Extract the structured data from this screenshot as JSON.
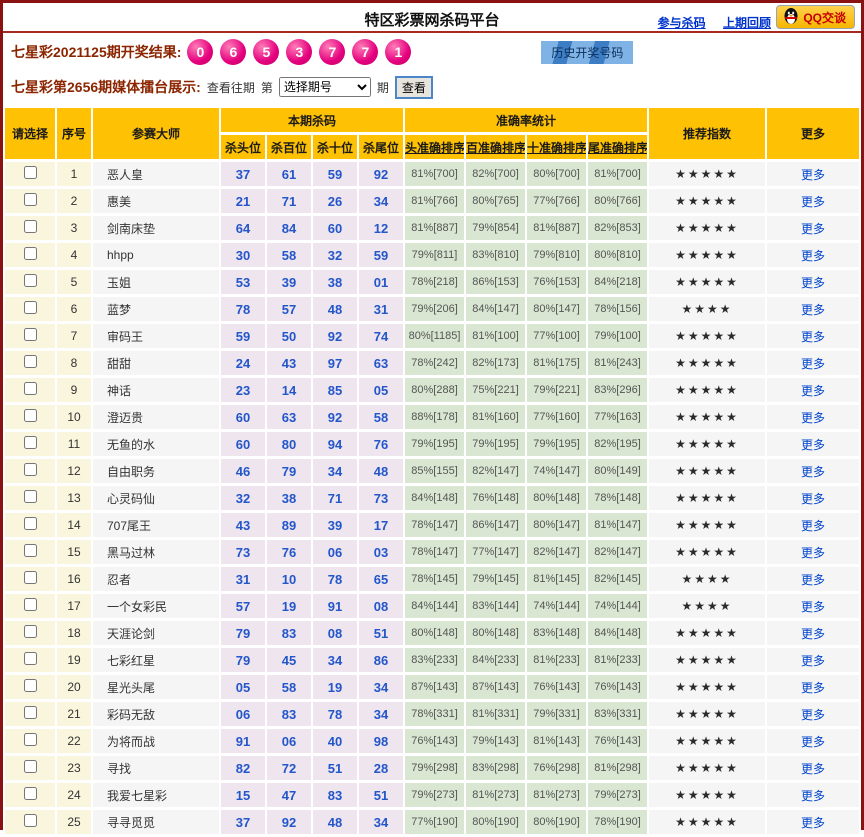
{
  "header": {
    "title": "特区彩票网杀码平台",
    "link_join": "参与杀码",
    "link_last": "上期回顾",
    "qq_button": "QQ交谈"
  },
  "result_bar": {
    "label": "七星彩2021125期开奖结果:",
    "balls": [
      "0",
      "6",
      "5",
      "3",
      "7",
      "7",
      "1"
    ],
    "history_link": "历史开奖号码"
  },
  "control_bar": {
    "label": "七星彩第2656期媒体擂台展示:",
    "view_past": "查看往期",
    "di": "第",
    "select_value": "选择期号",
    "qi": "期",
    "view_button": "查看"
  },
  "colors": {
    "header_gold": "#FFC103",
    "frame_maroon": "#8B1212",
    "ball_pink": "#E4007E",
    "kill_blue": "#2256C9",
    "acc_green_bg": "#D9E7D2",
    "link_blue": "#0033CC"
  },
  "table": {
    "headers": {
      "select": "请选择",
      "index": "序号",
      "master": "参赛大师",
      "kill_group": "本期杀码",
      "kill_cols": [
        "杀头位",
        "杀百位",
        "杀十位",
        "杀尾位"
      ],
      "acc_group": "准确率统计",
      "acc_cols": [
        "头准确排序",
        "百准确排序",
        "十准确排序",
        "尾准确排序"
      ],
      "rating": "推荐指数",
      "more": "更多"
    },
    "more_label": "更多",
    "rows": [
      {
        "index": "1",
        "master": "恶人皇",
        "kills": [
          "37",
          "61",
          "59",
          "92"
        ],
        "acc": [
          "81%[700]",
          "82%[700]",
          "80%[700]",
          "81%[700]"
        ],
        "stars": 5
      },
      {
        "index": "2",
        "master": "惠美",
        "kills": [
          "21",
          "71",
          "26",
          "34"
        ],
        "acc": [
          "81%[766]",
          "80%[765]",
          "77%[766]",
          "80%[766]"
        ],
        "stars": 5
      },
      {
        "index": "3",
        "master": "剑南床垫",
        "kills": [
          "64",
          "84",
          "60",
          "12"
        ],
        "acc": [
          "81%[887]",
          "79%[854]",
          "81%[887]",
          "82%[853]"
        ],
        "stars": 5
      },
      {
        "index": "4",
        "master": "hhpp",
        "kills": [
          "30",
          "58",
          "32",
          "59"
        ],
        "acc": [
          "79%[811]",
          "83%[810]",
          "79%[810]",
          "80%[810]"
        ],
        "stars": 5
      },
      {
        "index": "5",
        "master": "玉姐",
        "kills": [
          "53",
          "39",
          "38",
          "01"
        ],
        "acc": [
          "78%[218]",
          "86%[153]",
          "76%[153]",
          "84%[218]"
        ],
        "stars": 5
      },
      {
        "index": "6",
        "master": "蓝梦",
        "kills": [
          "78",
          "57",
          "48",
          "31"
        ],
        "acc": [
          "79%[206]",
          "84%[147]",
          "80%[147]",
          "78%[156]"
        ],
        "stars": 4
      },
      {
        "index": "7",
        "master": "审码王",
        "kills": [
          "59",
          "50",
          "92",
          "74"
        ],
        "acc": [
          "80%[1185]",
          "81%[100]",
          "77%[100]",
          "79%[100]"
        ],
        "stars": 5
      },
      {
        "index": "8",
        "master": "甜甜",
        "kills": [
          "24",
          "43",
          "97",
          "63"
        ],
        "acc": [
          "78%[242]",
          "82%[173]",
          "81%[175]",
          "81%[243]"
        ],
        "stars": 5
      },
      {
        "index": "9",
        "master": "神话",
        "kills": [
          "23",
          "14",
          "85",
          "05"
        ],
        "acc": [
          "80%[288]",
          "75%[221]",
          "79%[221]",
          "83%[296]"
        ],
        "stars": 5
      },
      {
        "index": "10",
        "master": "澄迈贵",
        "kills": [
          "60",
          "63",
          "92",
          "58"
        ],
        "acc": [
          "88%[178]",
          "81%[160]",
          "77%[160]",
          "77%[163]"
        ],
        "stars": 5
      },
      {
        "index": "11",
        "master": "无鱼的水",
        "kills": [
          "60",
          "80",
          "94",
          "76"
        ],
        "acc": [
          "79%[195]",
          "79%[195]",
          "79%[195]",
          "82%[195]"
        ],
        "stars": 5
      },
      {
        "index": "12",
        "master": "自由职务",
        "kills": [
          "46",
          "79",
          "34",
          "48"
        ],
        "acc": [
          "85%[155]",
          "82%[147]",
          "74%[147]",
          "80%[149]"
        ],
        "stars": 5
      },
      {
        "index": "13",
        "master": "心灵码仙",
        "kills": [
          "32",
          "38",
          "71",
          "73"
        ],
        "acc": [
          "84%[148]",
          "76%[148]",
          "80%[148]",
          "78%[148]"
        ],
        "stars": 5
      },
      {
        "index": "14",
        "master": "707尾王",
        "kills": [
          "43",
          "89",
          "39",
          "17"
        ],
        "acc": [
          "78%[147]",
          "86%[147]",
          "80%[147]",
          "81%[147]"
        ],
        "stars": 5
      },
      {
        "index": "15",
        "master": "黑马过林",
        "kills": [
          "73",
          "76",
          "06",
          "03"
        ],
        "acc": [
          "78%[147]",
          "77%[147]",
          "82%[147]",
          "82%[147]"
        ],
        "stars": 5
      },
      {
        "index": "16",
        "master": "忍者",
        "kills": [
          "31",
          "10",
          "78",
          "65"
        ],
        "acc": [
          "78%[145]",
          "79%[145]",
          "81%[145]",
          "82%[145]"
        ],
        "stars": 4
      },
      {
        "index": "17",
        "master": "一个女彩民",
        "kills": [
          "57",
          "19",
          "91",
          "08"
        ],
        "acc": [
          "84%[144]",
          "83%[144]",
          "74%[144]",
          "74%[144]"
        ],
        "stars": 4
      },
      {
        "index": "18",
        "master": "天涯论剑",
        "kills": [
          "79",
          "83",
          "08",
          "51"
        ],
        "acc": [
          "80%[148]",
          "80%[148]",
          "83%[148]",
          "84%[148]"
        ],
        "stars": 5
      },
      {
        "index": "19",
        "master": "七彩红星",
        "kills": [
          "79",
          "45",
          "34",
          "86"
        ],
        "acc": [
          "83%[233]",
          "84%[233]",
          "81%[233]",
          "81%[233]"
        ],
        "stars": 5
      },
      {
        "index": "20",
        "master": "星光头尾",
        "kills": [
          "05",
          "58",
          "19",
          "34"
        ],
        "acc": [
          "87%[143]",
          "87%[143]",
          "76%[143]",
          "76%[143]"
        ],
        "stars": 5
      },
      {
        "index": "21",
        "master": "彩码无敌",
        "kills": [
          "06",
          "83",
          "78",
          "34"
        ],
        "acc": [
          "78%[331]",
          "81%[331]",
          "79%[331]",
          "83%[331]"
        ],
        "stars": 5
      },
      {
        "index": "22",
        "master": "为将而战",
        "kills": [
          "91",
          "06",
          "40",
          "98"
        ],
        "acc": [
          "76%[143]",
          "79%[143]",
          "81%[143]",
          "76%[143]"
        ],
        "stars": 5
      },
      {
        "index": "23",
        "master": "寻找",
        "kills": [
          "82",
          "72",
          "51",
          "28"
        ],
        "acc": [
          "79%[298]",
          "83%[298]",
          "76%[298]",
          "81%[298]"
        ],
        "stars": 5
      },
      {
        "index": "24",
        "master": "我爱七星彩",
        "kills": [
          "15",
          "47",
          "83",
          "51"
        ],
        "acc": [
          "79%[273]",
          "81%[273]",
          "81%[273]",
          "79%[273]"
        ],
        "stars": 5
      },
      {
        "index": "25",
        "master": "寻寻觅觅",
        "kills": [
          "37",
          "92",
          "48",
          "34"
        ],
        "acc": [
          "77%[190]",
          "80%[190]",
          "80%[190]",
          "78%[190]"
        ],
        "stars": 5
      }
    ]
  }
}
